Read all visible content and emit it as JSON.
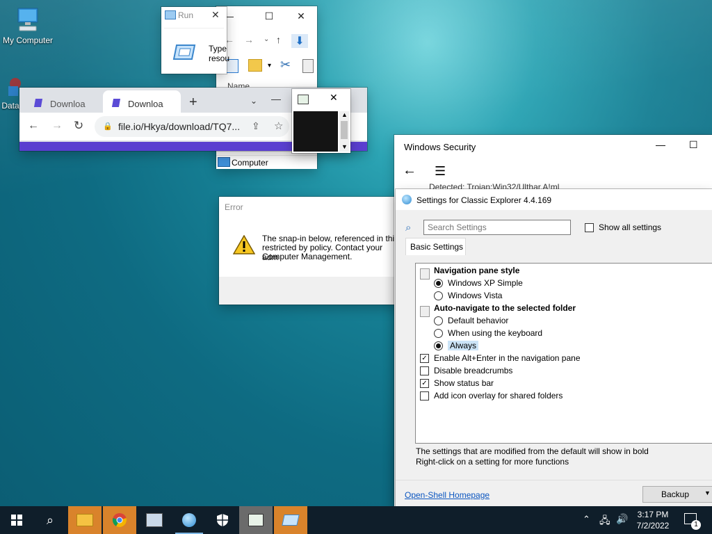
{
  "desktop": {
    "icons": [
      {
        "label": "My Computer"
      },
      {
        "label": "Data"
      }
    ]
  },
  "run": {
    "title": "Run",
    "text1": "Type",
    "text2": "resou"
  },
  "explorer": {
    "col_name": "Name",
    "item": "Computer"
  },
  "chrome": {
    "tabs": [
      {
        "label": "Downloa"
      },
      {
        "label": "Downloa"
      }
    ],
    "url": "file.io/Hkya/download/TQ7...",
    "new_tab": "+"
  },
  "error": {
    "title": "Error",
    "line1": "The snap-in below, referenced in this",
    "line2": "restricted by policy. Contact your adm",
    "line3": "Computer Management."
  },
  "security": {
    "title": "Windows Security",
    "detected": "Detected: Trojan:Win32/Ulthar.A!ml"
  },
  "classic": {
    "title": "Settings for Classic Explorer 4.4.169",
    "search_placeholder": "Search Settings",
    "show_all": "Show all settings",
    "tab": "Basic Settings",
    "groups": [
      {
        "label": "Navigation pane style",
        "options": [
          {
            "label": "Windows XP Simple",
            "selected": true
          },
          {
            "label": "Windows Vista",
            "selected": false
          }
        ]
      },
      {
        "label": "Auto-navigate to the selected folder",
        "options": [
          {
            "label": "Default behavior",
            "selected": false
          },
          {
            "label": "When using the keyboard",
            "selected": false
          },
          {
            "label": "Always",
            "selected": true
          }
        ]
      }
    ],
    "checks": [
      {
        "label": "Enable Alt+Enter in the navigation pane",
        "checked": true
      },
      {
        "label": "Disable breadcrumbs",
        "checked": false
      },
      {
        "label": "Show status bar",
        "checked": true
      },
      {
        "label": "Add icon overlay for shared folders",
        "checked": false
      }
    ],
    "note1": "The settings that are modified from the default will show in bold",
    "note2": "Right-click on a setting for more functions",
    "homepage": "Open-Shell Homepage",
    "backup": "Backup"
  },
  "taskbar": {
    "time": "3:17 PM",
    "date": "7/2/2022",
    "notif_count": "1"
  }
}
